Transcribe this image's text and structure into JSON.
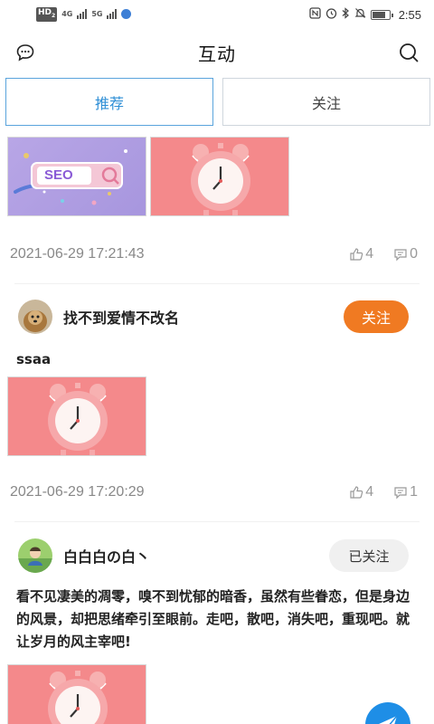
{
  "status_bar": {
    "hd_badge": "HD",
    "hd_sub": "2",
    "net1_top": "4G",
    "net2_top": "5G",
    "time": "2:55",
    "icons": [
      "nfc-icon",
      "alarm-icon",
      "bluetooth-icon",
      "mute-icon",
      "battery-icon"
    ]
  },
  "header": {
    "title": "互动",
    "left_icon": "chat-bubble-icon",
    "right_icon": "search-icon"
  },
  "tabs": [
    {
      "label": "推荐",
      "active": true
    },
    {
      "label": "关注",
      "active": false
    }
  ],
  "colors": {
    "accent_blue": "#2f8fd6",
    "follow_orange": "#f07a22",
    "fab_blue": "#1e8ee6"
  },
  "posts": [
    {
      "images": [
        "seo-image",
        "alarm-clock-image"
      ],
      "seo_text": "SEO",
      "timestamp": "2021-06-29 17:21:43",
      "likes": "4",
      "comments": "0"
    },
    {
      "author": "找不到爱情不改名",
      "follow_label": "关注",
      "text": "ssaa",
      "images": [
        "alarm-clock-image"
      ],
      "timestamp": "2021-06-29 17:20:29",
      "likes": "4",
      "comments": "1"
    },
    {
      "author": "白白白の白丶",
      "follow_label": "已关注",
      "text": "看不见凄美的凋零，嗅不到忧郁的暗香，虽然有些眷恋，但是身边的风景，却把思绪牵引至眼前。走吧，散吧，消失吧，重现吧。就让岁月的风主宰吧!",
      "images": [
        "alarm-clock-image"
      ]
    }
  ],
  "fab": {
    "icon": "send-plane-icon"
  }
}
